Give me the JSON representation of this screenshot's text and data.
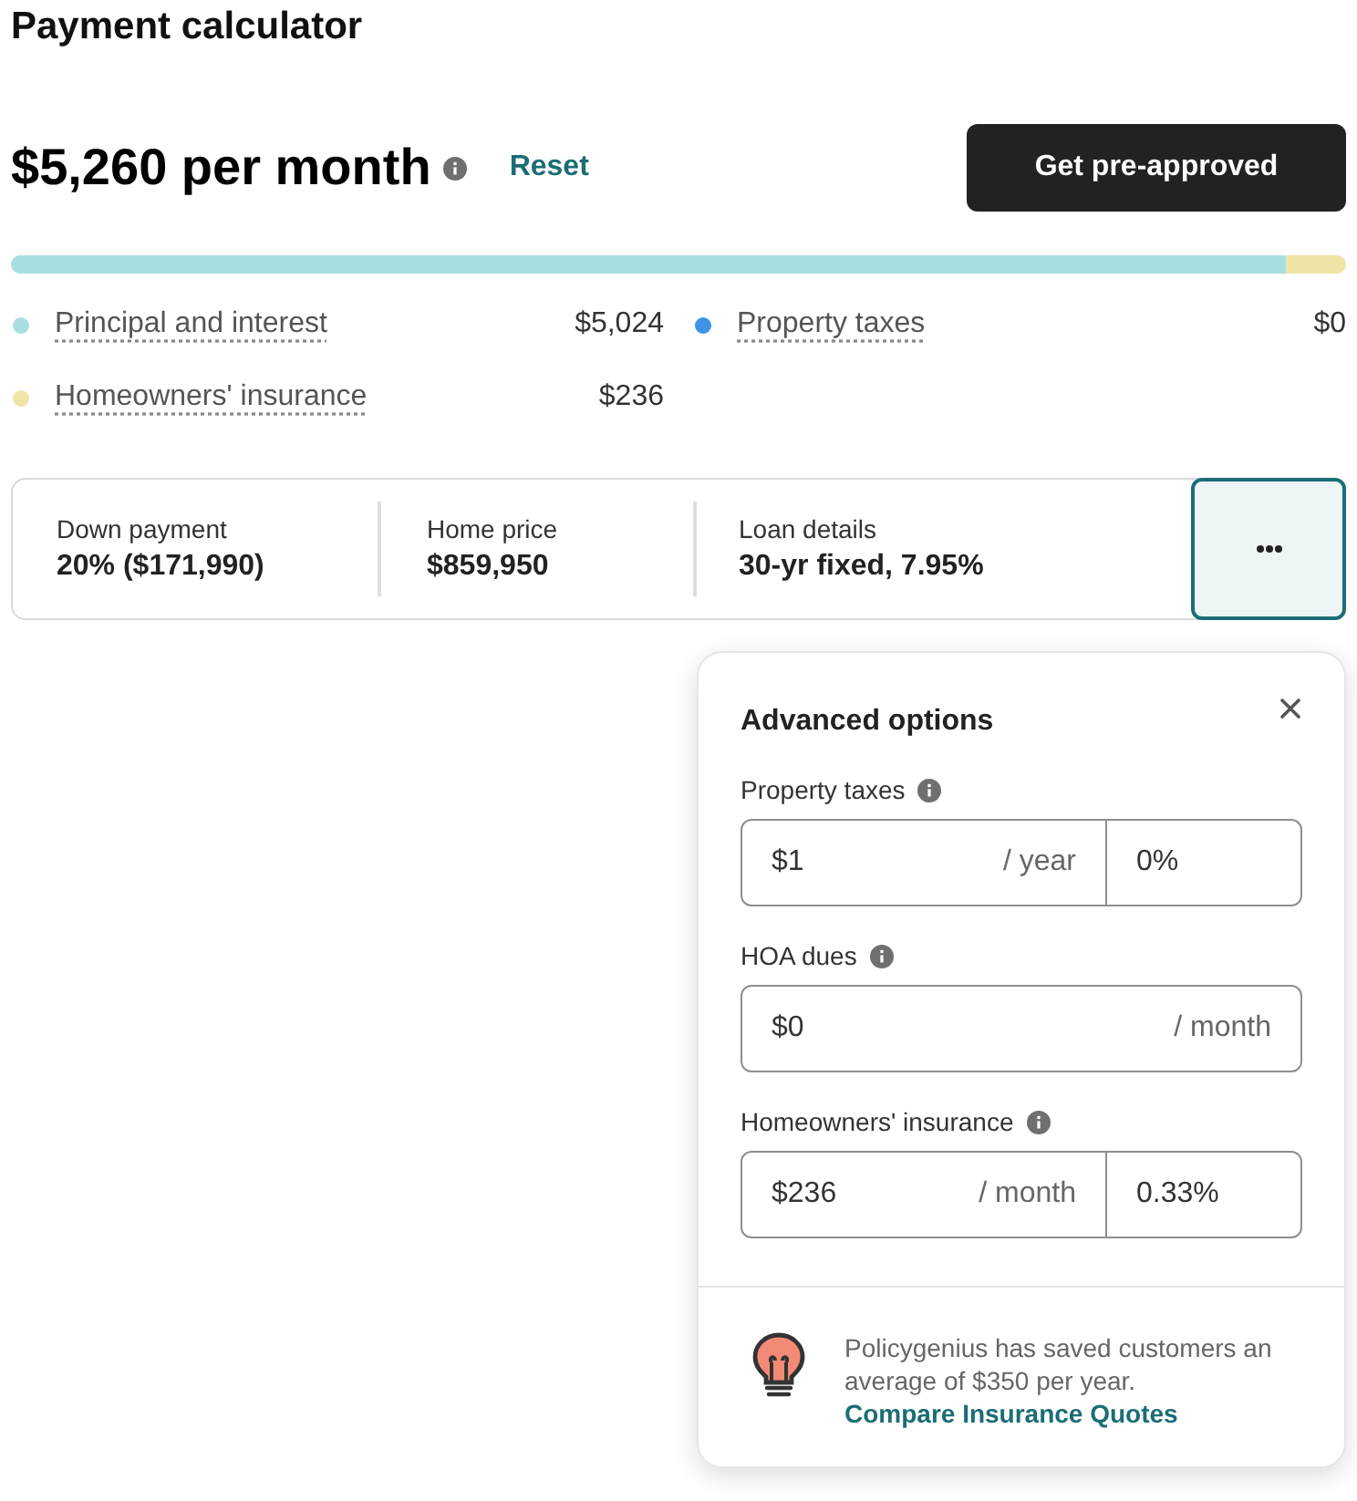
{
  "title": "Payment calculator",
  "summary": {
    "monthly_payment": "$5,260 per month",
    "reset": "Reset",
    "cta": "Get pre-approved"
  },
  "breakdown": [
    {
      "label": "Principal and interest",
      "amount": "$5,024",
      "color": "#a9dfe3",
      "level": 0.955
    },
    {
      "label": "Property taxes",
      "amount": "$0",
      "color": "#3f93e6"
    },
    {
      "label": "Homeowners' insurance",
      "amount": "$236",
      "color": "#efe5a8",
      "level": 0.045
    }
  ],
  "loan_summary": [
    {
      "label": "Down payment",
      "value": "20% ($171,990)"
    },
    {
      "label": "Home price",
      "value": "$859,950"
    },
    {
      "label": "Loan details",
      "value": "30-yr fixed, 7.95%"
    }
  ],
  "advanced_options": {
    "title": "Advanced options",
    "expanded": true,
    "fields": [
      {
        "label": "Property taxes",
        "amount": "$1",
        "unit": "/ year",
        "percent": "0%"
      },
      {
        "label": "HOA dues",
        "amount": "$0",
        "unit": "/ month"
      },
      {
        "label": "Homeowners' insurance",
        "amount": "$236",
        "unit": "/ month",
        "percent": "0.33%"
      }
    ],
    "promo": {
      "text": "Policygenius has saved customers an average of $350 per year.",
      "link": "Compare Insurance Quotes"
    }
  }
}
